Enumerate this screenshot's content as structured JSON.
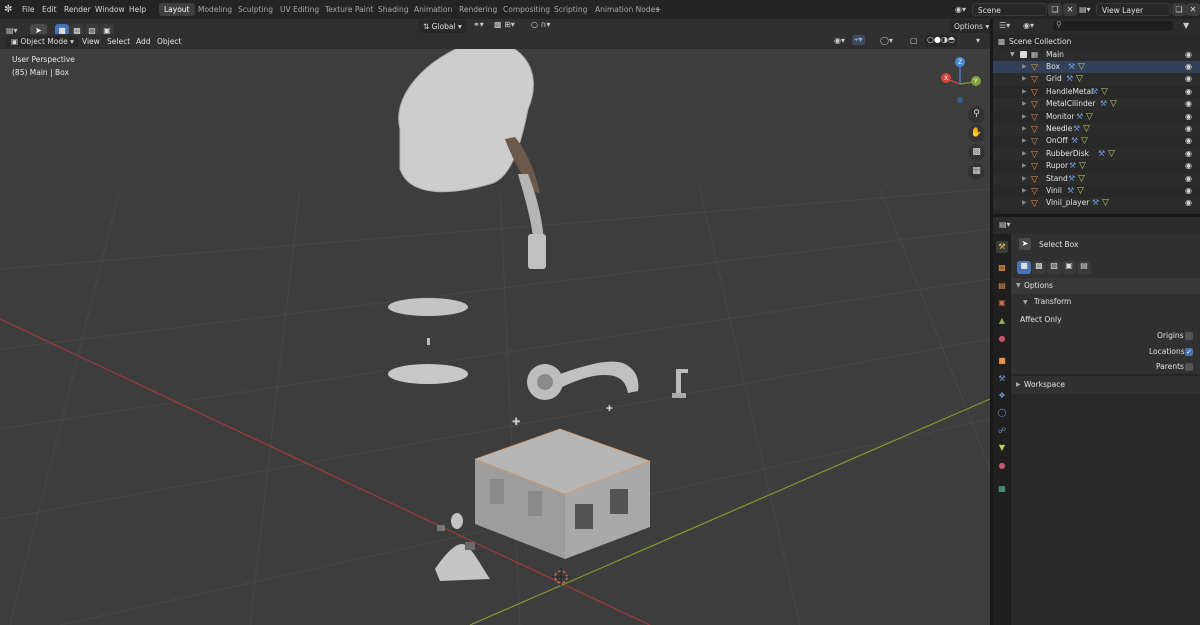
{
  "topbar": {
    "menus": [
      "File",
      "Edit",
      "Render",
      "Window",
      "Help"
    ],
    "workspaces": [
      "Layout",
      "Modeling",
      "Sculpting",
      "UV Editing",
      "Texture Paint",
      "Shading",
      "Animation",
      "Rendering",
      "Compositing",
      "Scripting",
      "Animation Nodes"
    ],
    "active_workspace": "Layout",
    "scene": "Scene",
    "view_layer": "View Layer"
  },
  "viewport_header": {
    "mode": "Object Mode",
    "menus": [
      "View",
      "Select",
      "Add",
      "Object"
    ],
    "orientation": "Global",
    "options": "Options"
  },
  "viewport": {
    "perspective": "User Perspective",
    "context": "(85) Main | Box",
    "gizmo_axes": {
      "x": "X",
      "y": "Y",
      "z": "Z"
    }
  },
  "outliner": {
    "root": "Scene Collection",
    "collection": "Main",
    "objects": [
      "Box",
      "Grid",
      "HandleMetal",
      "MetalCilinder",
      "Monitor",
      "Needle",
      "OnOff",
      "RubberDisk",
      "Rupor",
      "Stand",
      "Vinil",
      "Vinil_player"
    ],
    "selected": "Box"
  },
  "properties": {
    "tool_name": "Select Box",
    "options_panel": "Options",
    "transform_sub": "Transform",
    "affect_only": "Affect Only",
    "origins": "Origins",
    "locations": "Locations",
    "parents": "Parents",
    "workspace_panel": "Workspace",
    "origins_checked": false,
    "locations_checked": true,
    "parents_checked": false
  },
  "colors": {
    "accent_blue": "#4772b3",
    "object_orange": "#e8924a",
    "x_axis": "#a03a3a",
    "y_axis": "#7f9c2c"
  }
}
